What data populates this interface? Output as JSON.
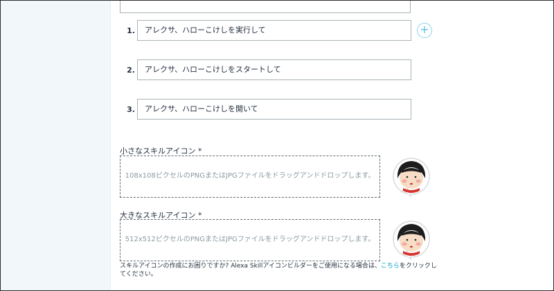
{
  "utterances": [
    {
      "num": "1.",
      "text": "アレクサ、ハローこけしを実行して"
    },
    {
      "num": "2.",
      "text": "アレクサ、ハローこけしをスタートして"
    },
    {
      "num": "3.",
      "text": "アレクサ、ハローこけしを開いて"
    }
  ],
  "add_button": {
    "label": "+"
  },
  "small_icon": {
    "label": "小さなスキルアイコン *",
    "hint": "108x108ピクセルのPNGまたはJPGファイルをドラッグアンドドロップします。"
  },
  "large_icon": {
    "label": "大きなスキルアイコン *",
    "hint": "512x512ピクセルのPNGまたはJPGファイルをドラッグアンドドロップします。"
  },
  "helper": {
    "before": "スキルアイコンの作成にお困りですか? Alexa Skillアイコンビルダーをご使用になる場合は、",
    "link": "こちら",
    "after": "をクリックしてください。"
  },
  "colors": {
    "sidebar_bg": "#f2f8f9",
    "link": "#0aa1d4",
    "add_button": "#59bfe6",
    "border": "#a9b3b5"
  }
}
